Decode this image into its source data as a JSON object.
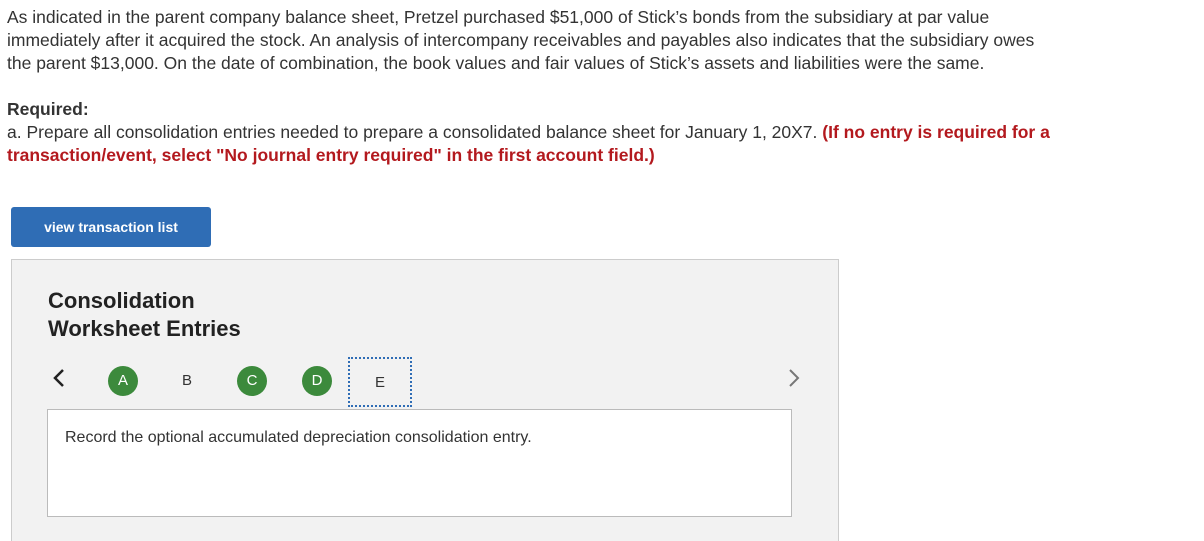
{
  "intro": {
    "line1": "As indicated in the parent company balance sheet, Pretzel purchased $51,000 of Stick’s bonds from the subsidiary at par value",
    "line2": "immediately after it acquired the stock. An analysis of intercompany receivables and payables also indicates that the subsidiary owes",
    "line3": "the parent $13,000. On the date of combination, the book values and fair values of Stick’s assets and liabilities were the same."
  },
  "required": {
    "label": "Required:",
    "text": "a. Prepare all consolidation entries needed to prepare a consolidated balance sheet for January 1, 20X7.",
    "note": "(If no entry is required for a transaction/event, select \"No journal entry required\" in the first account field.)"
  },
  "toolbar": {
    "view_transactions_label": "view transaction list"
  },
  "panel": {
    "title_line1": "Consolidation",
    "title_line2": "Worksheet Entries",
    "steps": [
      {
        "label": "A",
        "state": "completed"
      },
      {
        "label": "B",
        "state": "not-completed"
      },
      {
        "label": "C",
        "state": "completed"
      },
      {
        "label": "D",
        "state": "completed"
      },
      {
        "label": "E",
        "state": "current"
      }
    ],
    "entry_instruction": "Record the optional accumulated depreciation consolidation entry.",
    "prev_icon": "chevron-left-icon",
    "next_icon": "chevron-right-icon"
  },
  "colors": {
    "button_blue": "#2f6db5",
    "completed_green": "#3c8a3c",
    "note_red": "#b3191e",
    "panel_bg": "#f2f2f2"
  }
}
